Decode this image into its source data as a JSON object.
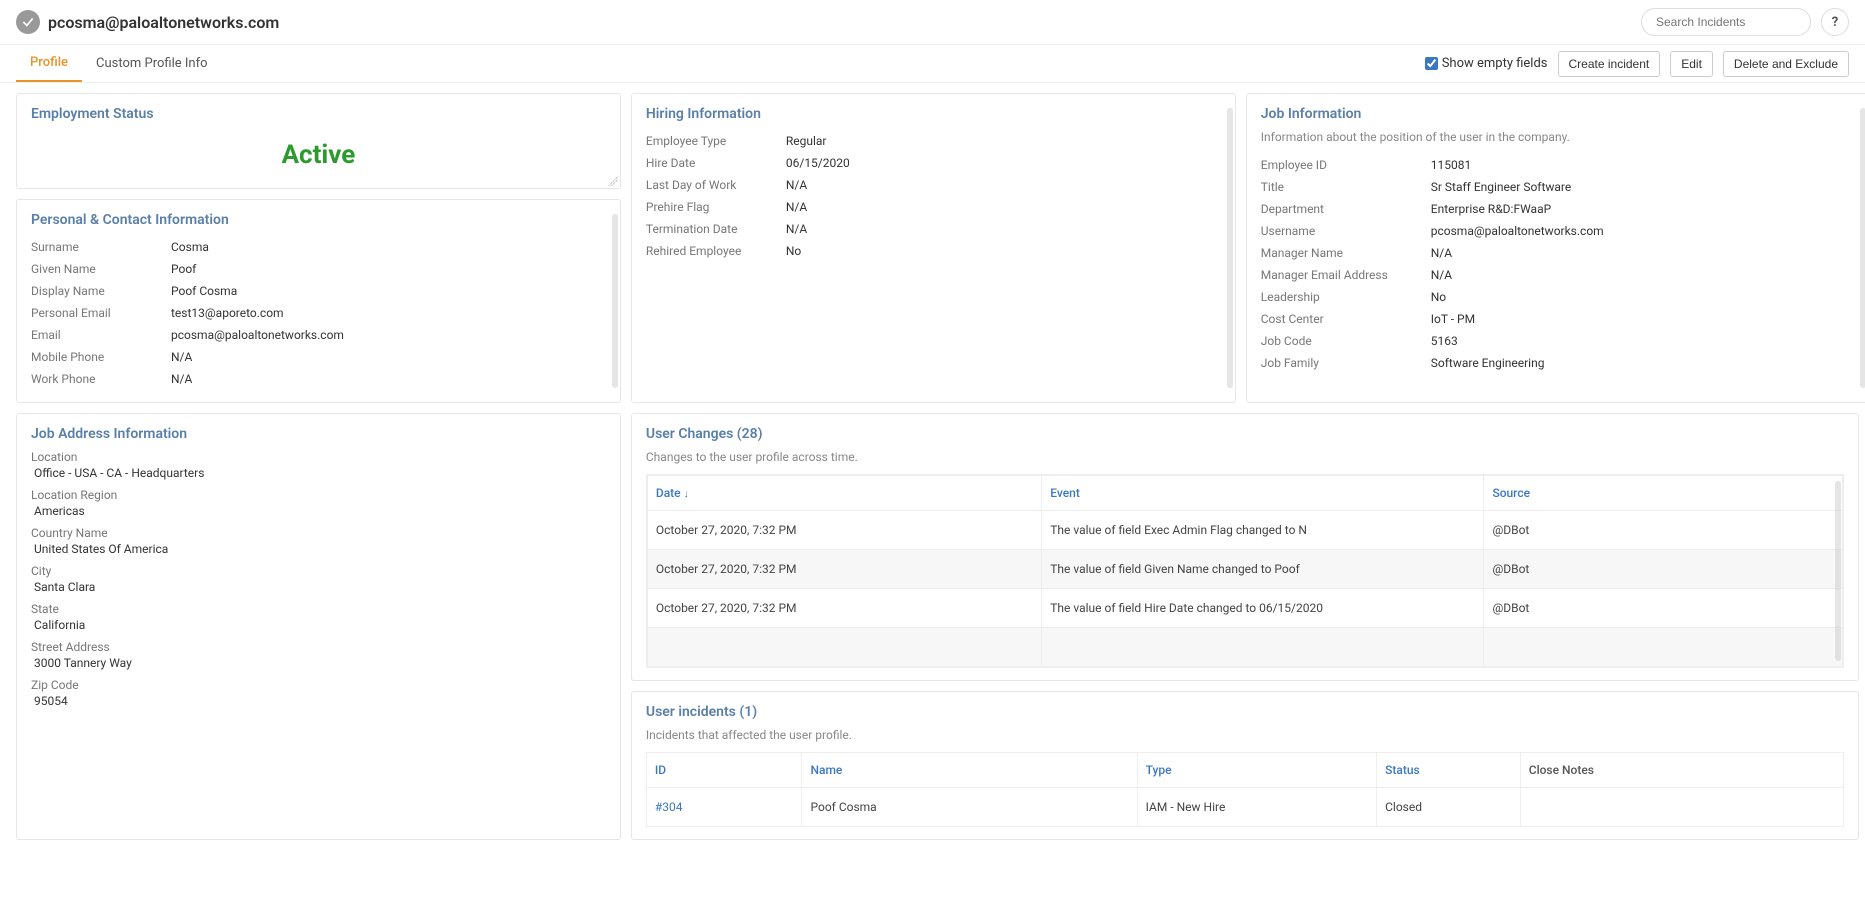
{
  "header": {
    "title": "pcosma@paloaltonetworks.com",
    "search_placeholder": "Search Incidents",
    "help": "?"
  },
  "tabs": {
    "profile": "Profile",
    "custom": "Custom Profile Info",
    "show_empty": "Show empty fields",
    "create_incident": "Create incident",
    "edit": "Edit",
    "delete_exclude": "Delete and Exclude"
  },
  "employment_status": {
    "title": "Employment Status",
    "value": "Active"
  },
  "personal": {
    "title": "Personal & Contact Information",
    "rows": {
      "surname_l": "Surname",
      "surname_v": "Cosma",
      "given_l": "Given Name",
      "given_v": "Poof",
      "display_l": "Display Name",
      "display_v": "Poof Cosma",
      "pemail_l": "Personal Email",
      "pemail_v": "test13@aporeto.com",
      "email_l": "Email",
      "email_v": "pcosma@paloaltonetworks.com",
      "mobile_l": "Mobile Phone",
      "mobile_v": "N/A",
      "work_l": "Work Phone",
      "work_v": "N/A"
    }
  },
  "hiring": {
    "title": "Hiring Information",
    "rows": {
      "etype_l": "Employee Type",
      "etype_v": "Regular",
      "hdate_l": "Hire Date",
      "hdate_v": "06/15/2020",
      "lday_l": "Last Day of Work",
      "lday_v": "N/A",
      "prehire_l": "Prehire Flag",
      "prehire_v": "N/A",
      "term_l": "Termination Date",
      "term_v": "N/A",
      "rehire_l": "Rehired Employee",
      "rehire_v": "No"
    }
  },
  "job": {
    "title": "Job Information",
    "desc": "Information about the position of the user in the company.",
    "rows": {
      "eid_l": "Employee ID",
      "eid_v": "115081",
      "title_l": "Title",
      "title_v": "Sr Staff Engineer Software",
      "dept_l": "Department",
      "dept_v": "Enterprise R&D:FWaaP",
      "user_l": "Username",
      "user_v": "pcosma@paloaltonetworks.com",
      "mname_l": "Manager Name",
      "mname_v": "N/A",
      "memail_l": "Manager Email Address",
      "memail_v": "N/A",
      "lead_l": "Leadership",
      "lead_v": "No",
      "cost_l": "Cost Center",
      "cost_v": "IoT - PM",
      "jcode_l": "Job Code",
      "jcode_v": "5163",
      "jfam_l": "Job Family",
      "jfam_v": "Software Engineering"
    }
  },
  "address": {
    "title": "Job Address Information",
    "loc_l": "Location",
    "loc_v": "Office - USA - CA - Headquarters",
    "region_l": "Location Region",
    "region_v": "Americas",
    "country_l": "Country Name",
    "country_v": "United States Of America",
    "city_l": "City",
    "city_v": "Santa Clara",
    "state_l": "State",
    "state_v": "California",
    "street_l": "Street Address",
    "street_v": "3000 Tannery Way",
    "zip_l": "Zip Code",
    "zip_v": "95054"
  },
  "changes": {
    "title": "User Changes (28)",
    "desc": "Changes to the user profile across time.",
    "col_date": "Date",
    "col_event": "Event",
    "col_source": "Source",
    "rows": [
      {
        "d": "October 27, 2020, 7:32 PM",
        "e": "The value of field Exec Admin Flag changed to N",
        "s": "@DBot"
      },
      {
        "d": "October 27, 2020, 7:32 PM",
        "e": "The value of field Given Name changed to Poof",
        "s": "@DBot"
      },
      {
        "d": "October 27, 2020, 7:32 PM",
        "e": "The value of field Hire Date changed to 06/15/2020",
        "s": "@DBot"
      }
    ]
  },
  "incidents": {
    "title": "User incidents (1)",
    "desc": "Incidents that affected the user profile.",
    "col_id": "ID",
    "col_name": "Name",
    "col_type": "Type",
    "col_status": "Status",
    "col_notes": "Close Notes",
    "rows": [
      {
        "id": "#304",
        "name": "Poof Cosma",
        "type": "IAM - New Hire",
        "status": "Closed",
        "notes": ""
      }
    ]
  }
}
